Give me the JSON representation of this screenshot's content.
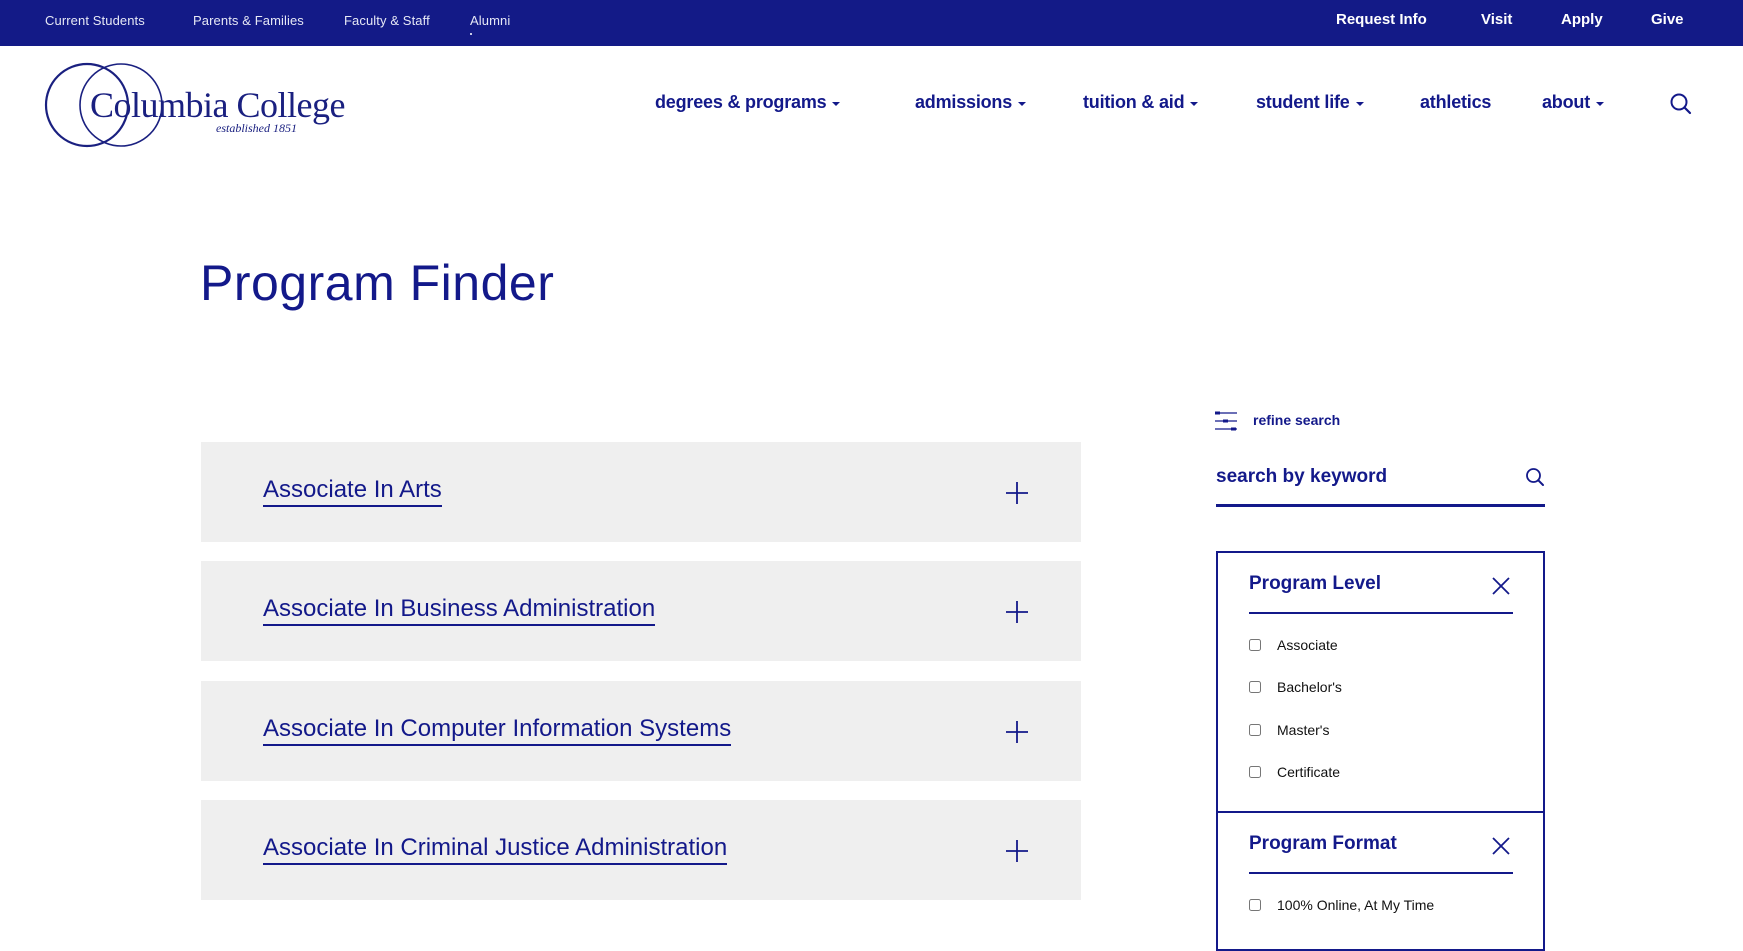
{
  "utility_nav": {
    "links": [
      "Current Students",
      "Parents & Families",
      "Faculty & Staff",
      "Alumni"
    ],
    "cta": [
      "Request Info",
      "Visit",
      "Apply",
      "Give"
    ]
  },
  "header": {
    "logo": {
      "name": "Columbia College",
      "tagline": "established 1851"
    },
    "nav": [
      {
        "label": "degrees & programs",
        "dropdown": true
      },
      {
        "label": "admissions",
        "dropdown": true
      },
      {
        "label": "tuition & aid",
        "dropdown": true
      },
      {
        "label": "student life",
        "dropdown": true
      },
      {
        "label": "athletics",
        "dropdown": false
      },
      {
        "label": "about",
        "dropdown": true
      }
    ],
    "search_icon": "search-icon"
  },
  "page": {
    "title": "Program Finder"
  },
  "programs": [
    {
      "label": "Associate In Arts",
      "icon": "plus-icon"
    },
    {
      "label": "Associate In Business Administration",
      "icon": "plus-icon"
    },
    {
      "label": "Associate In Computer Information Systems",
      "icon": "plus-icon"
    },
    {
      "label": "Associate In Criminal Justice Administration",
      "icon": "plus-icon"
    }
  ],
  "sidebar": {
    "refine_label": "refine search",
    "refine_icon": "sliders-icon",
    "keyword": {
      "value": "",
      "placeholder": "search by keyword"
    },
    "filters": [
      {
        "title": "Program Level",
        "options": [
          {
            "label": "Associate",
            "checked": false
          },
          {
            "label": "Bachelor's",
            "checked": false
          },
          {
            "label": "Master's",
            "checked": false
          },
          {
            "label": "Certificate",
            "checked": false
          }
        ]
      },
      {
        "title": "Program Format",
        "options": [
          {
            "label": "100% Online, At My Time",
            "checked": false
          }
        ]
      }
    ]
  },
  "colors": {
    "brand_navy": "#131a87",
    "card_bg": "#efefef",
    "text_dark": "#111111"
  }
}
